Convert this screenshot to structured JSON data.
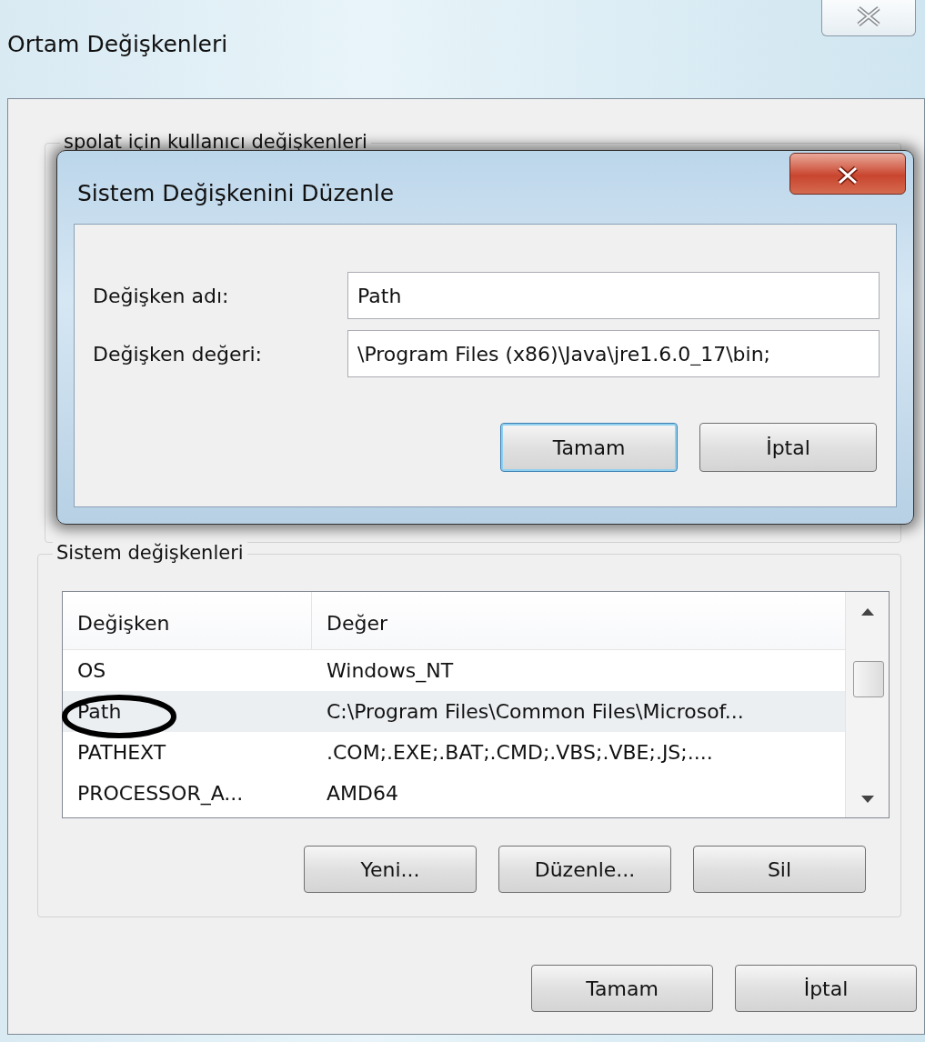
{
  "window": {
    "title": "Ortam Değişkenleri"
  },
  "user_variables": {
    "title": "spolat için kullanıcı değişkenleri"
  },
  "edit_dialog": {
    "title": "Sistem Değişkenini Düzenle",
    "fields": [
      {
        "label": "Değişken adı:",
        "value": "Path"
      },
      {
        "label": "Değişken değeri:",
        "value": "\\Program Files (x86)\\Java\\jre1.6.0_17\\bin;"
      }
    ],
    "buttons": [
      {
        "label": "Tamam",
        "default": true
      },
      {
        "label": "İptal",
        "default": false
      }
    ]
  },
  "system_variables": {
    "title": "Sistem değişkenleri",
    "columns": [
      "Değişken",
      "Değer"
    ],
    "rows": [
      {
        "name": "OS",
        "value": "Windows_NT",
        "selected": false,
        "circled": false
      },
      {
        "name": "Path",
        "value": "C:\\Program Files\\Common Files\\Microsof...",
        "selected": true,
        "circled": true
      },
      {
        "name": "PATHEXT",
        "value": ".COM;.EXE;.BAT;.CMD;.VBS;.VBE;.JS;....",
        "selected": false,
        "circled": false
      },
      {
        "name": "PROCESSOR_A...",
        "value": "AMD64",
        "selected": false,
        "circled": false
      }
    ],
    "buttons": [
      "Yeni...",
      "Düzenle...",
      "Sil"
    ]
  },
  "buttons": [
    "Tamam",
    "İptal"
  ]
}
